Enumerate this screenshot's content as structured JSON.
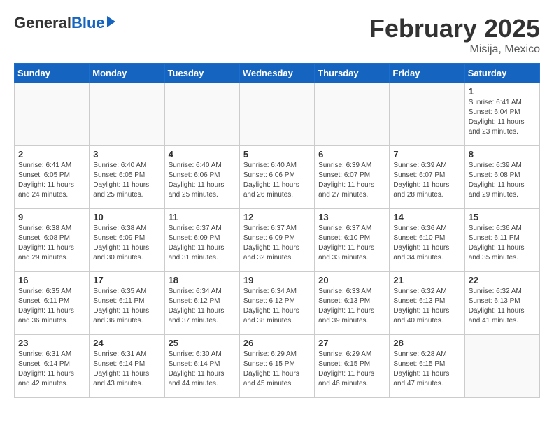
{
  "header": {
    "logo_general": "General",
    "logo_blue": "Blue",
    "month_title": "February 2025",
    "location": "Misija, Mexico"
  },
  "weekdays": [
    "Sunday",
    "Monday",
    "Tuesday",
    "Wednesday",
    "Thursday",
    "Friday",
    "Saturday"
  ],
  "weeks": [
    [
      {
        "day": "",
        "info": ""
      },
      {
        "day": "",
        "info": ""
      },
      {
        "day": "",
        "info": ""
      },
      {
        "day": "",
        "info": ""
      },
      {
        "day": "",
        "info": ""
      },
      {
        "day": "",
        "info": ""
      },
      {
        "day": "1",
        "info": "Sunrise: 6:41 AM\nSunset: 6:04 PM\nDaylight: 11 hours\nand 23 minutes."
      }
    ],
    [
      {
        "day": "2",
        "info": "Sunrise: 6:41 AM\nSunset: 6:05 PM\nDaylight: 11 hours\nand 24 minutes."
      },
      {
        "day": "3",
        "info": "Sunrise: 6:40 AM\nSunset: 6:05 PM\nDaylight: 11 hours\nand 25 minutes."
      },
      {
        "day": "4",
        "info": "Sunrise: 6:40 AM\nSunset: 6:06 PM\nDaylight: 11 hours\nand 25 minutes."
      },
      {
        "day": "5",
        "info": "Sunrise: 6:40 AM\nSunset: 6:06 PM\nDaylight: 11 hours\nand 26 minutes."
      },
      {
        "day": "6",
        "info": "Sunrise: 6:39 AM\nSunset: 6:07 PM\nDaylight: 11 hours\nand 27 minutes."
      },
      {
        "day": "7",
        "info": "Sunrise: 6:39 AM\nSunset: 6:07 PM\nDaylight: 11 hours\nand 28 minutes."
      },
      {
        "day": "8",
        "info": "Sunrise: 6:39 AM\nSunset: 6:08 PM\nDaylight: 11 hours\nand 29 minutes."
      }
    ],
    [
      {
        "day": "9",
        "info": "Sunrise: 6:38 AM\nSunset: 6:08 PM\nDaylight: 11 hours\nand 29 minutes."
      },
      {
        "day": "10",
        "info": "Sunrise: 6:38 AM\nSunset: 6:09 PM\nDaylight: 11 hours\nand 30 minutes."
      },
      {
        "day": "11",
        "info": "Sunrise: 6:37 AM\nSunset: 6:09 PM\nDaylight: 11 hours\nand 31 minutes."
      },
      {
        "day": "12",
        "info": "Sunrise: 6:37 AM\nSunset: 6:09 PM\nDaylight: 11 hours\nand 32 minutes."
      },
      {
        "day": "13",
        "info": "Sunrise: 6:37 AM\nSunset: 6:10 PM\nDaylight: 11 hours\nand 33 minutes."
      },
      {
        "day": "14",
        "info": "Sunrise: 6:36 AM\nSunset: 6:10 PM\nDaylight: 11 hours\nand 34 minutes."
      },
      {
        "day": "15",
        "info": "Sunrise: 6:36 AM\nSunset: 6:11 PM\nDaylight: 11 hours\nand 35 minutes."
      }
    ],
    [
      {
        "day": "16",
        "info": "Sunrise: 6:35 AM\nSunset: 6:11 PM\nDaylight: 11 hours\nand 36 minutes."
      },
      {
        "day": "17",
        "info": "Sunrise: 6:35 AM\nSunset: 6:11 PM\nDaylight: 11 hours\nand 36 minutes."
      },
      {
        "day": "18",
        "info": "Sunrise: 6:34 AM\nSunset: 6:12 PM\nDaylight: 11 hours\nand 37 minutes."
      },
      {
        "day": "19",
        "info": "Sunrise: 6:34 AM\nSunset: 6:12 PM\nDaylight: 11 hours\nand 38 minutes."
      },
      {
        "day": "20",
        "info": "Sunrise: 6:33 AM\nSunset: 6:13 PM\nDaylight: 11 hours\nand 39 minutes."
      },
      {
        "day": "21",
        "info": "Sunrise: 6:32 AM\nSunset: 6:13 PM\nDaylight: 11 hours\nand 40 minutes."
      },
      {
        "day": "22",
        "info": "Sunrise: 6:32 AM\nSunset: 6:13 PM\nDaylight: 11 hours\nand 41 minutes."
      }
    ],
    [
      {
        "day": "23",
        "info": "Sunrise: 6:31 AM\nSunset: 6:14 PM\nDaylight: 11 hours\nand 42 minutes."
      },
      {
        "day": "24",
        "info": "Sunrise: 6:31 AM\nSunset: 6:14 PM\nDaylight: 11 hours\nand 43 minutes."
      },
      {
        "day": "25",
        "info": "Sunrise: 6:30 AM\nSunset: 6:14 PM\nDaylight: 11 hours\nand 44 minutes."
      },
      {
        "day": "26",
        "info": "Sunrise: 6:29 AM\nSunset: 6:15 PM\nDaylight: 11 hours\nand 45 minutes."
      },
      {
        "day": "27",
        "info": "Sunrise: 6:29 AM\nSunset: 6:15 PM\nDaylight: 11 hours\nand 46 minutes."
      },
      {
        "day": "28",
        "info": "Sunrise: 6:28 AM\nSunset: 6:15 PM\nDaylight: 11 hours\nand 47 minutes."
      },
      {
        "day": "",
        "info": ""
      }
    ]
  ]
}
